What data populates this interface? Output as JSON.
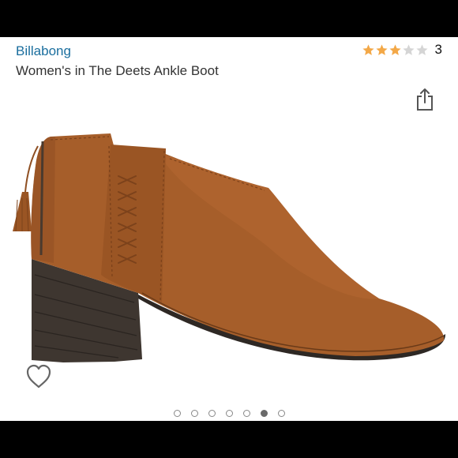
{
  "product": {
    "brand": "Billabong",
    "title": "Women's in The Deets Ankle Boot",
    "rating": {
      "stars": 3,
      "max_stars": 5,
      "count": "3"
    },
    "image": {
      "icon": "ankle-boot-image",
      "color": "#a65e2a"
    }
  },
  "icons": {
    "share": "share-icon",
    "wishlist": "heart-icon"
  },
  "carousel": {
    "total": 7,
    "active_index": 5
  },
  "colors": {
    "brand_link": "#1a6e9e",
    "star_filled": "#f3a847",
    "star_empty": "#d5d5d5"
  }
}
